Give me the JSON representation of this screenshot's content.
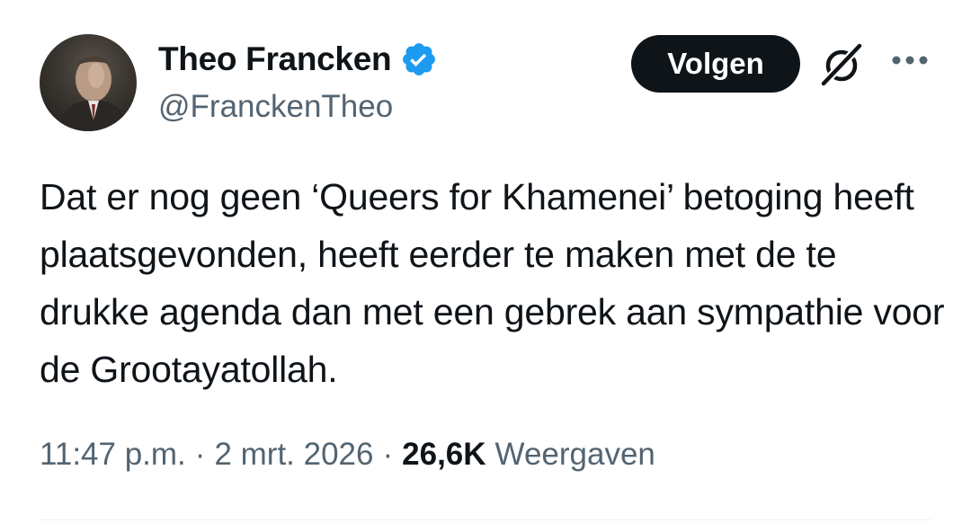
{
  "tweet": {
    "author": {
      "display_name": "Theo Francken",
      "handle": "@FranckenTheo",
      "verified": true,
      "avatar_icon": "profile-photo"
    },
    "follow_label": "Volgen",
    "text": "Dat er nog geen ‘Queers for Khamenei’ betoging heeft plaatsgevonden, heeft eerder te maken met de te drukke agenda dan met een gebrek aan sympathie voor de Grootayatollah.",
    "time": "11:47 p.m.",
    "separator": "·",
    "date": "2 mrt. 2026",
    "views_count": "26,6K",
    "views_label": "Weergaven",
    "icons": {
      "verified": "verified-badge-icon",
      "grok": "grok-icon",
      "more": "more-options-icon"
    },
    "colors": {
      "verified_blue": "#1d9bf0",
      "text": "#0f1419",
      "secondary_text": "#536471",
      "button_bg": "#0f1419",
      "button_text": "#ffffff"
    }
  }
}
